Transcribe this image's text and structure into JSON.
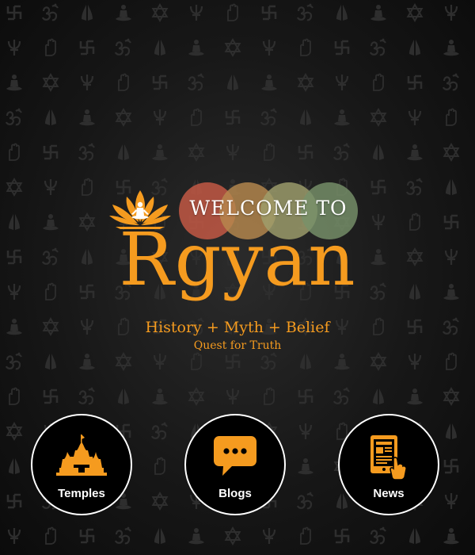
{
  "hero": {
    "welcome_text": "WELCOME TO",
    "brand": "Rgyan",
    "tagline": "History + Myth + Belief",
    "subtagline": "Quest for Truth",
    "welcome_circle_colors": [
      "#c85a46",
      "#b7894e",
      "#9f9f6c",
      "#77916a"
    ]
  },
  "nav": {
    "items": [
      {
        "label": "Temples",
        "icon": "temple-icon"
      },
      {
        "label": "Blogs",
        "icon": "chat-bubble-icon"
      },
      {
        "label": "News",
        "icon": "news-tablet-icon"
      }
    ]
  },
  "colors": {
    "accent": "#f59b1f",
    "background": "#171717",
    "pattern": "#2e2e2e"
  },
  "background_pattern": {
    "symbols": [
      "swastika-icon",
      "star-of-david-icon",
      "om-icon",
      "trishul-icon",
      "praying-hands-icon",
      "hand-icon",
      "meditating-figure-icon"
    ]
  }
}
